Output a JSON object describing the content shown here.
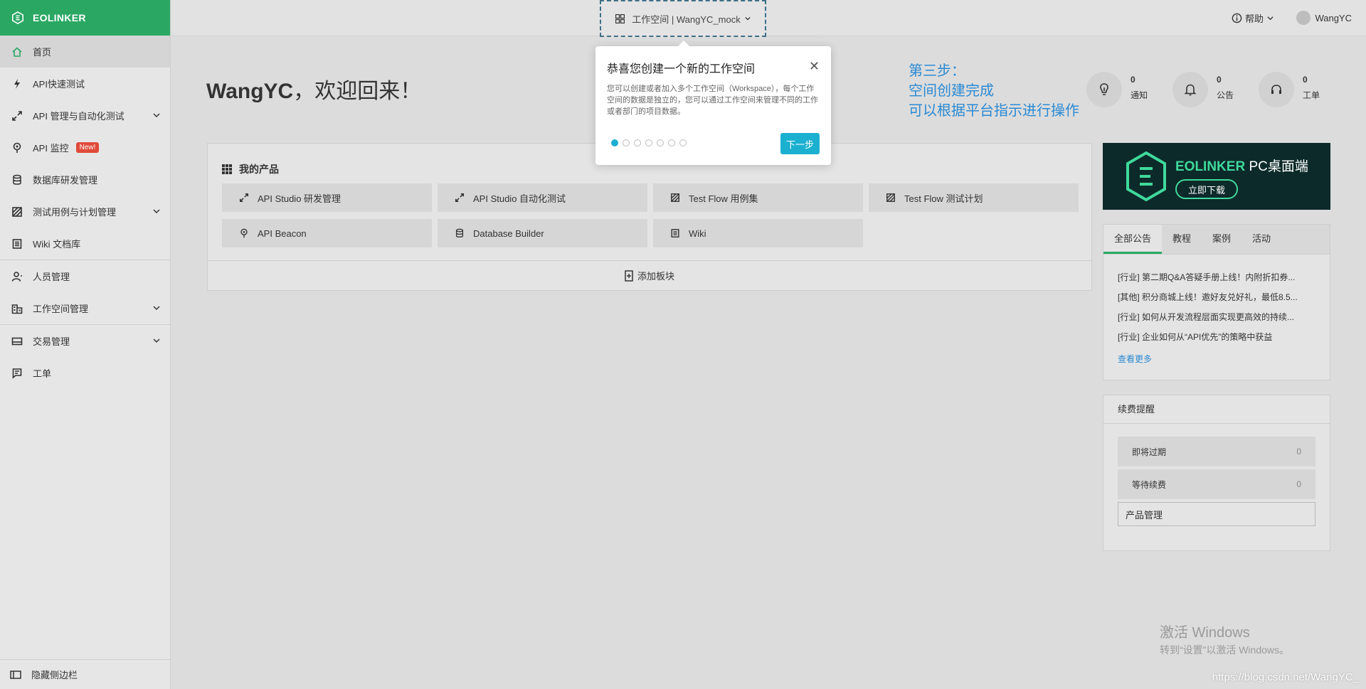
{
  "brand": {
    "name": "EOLINKER"
  },
  "sidebar": {
    "items": [
      {
        "label": "首页",
        "icon": "home-icon",
        "active": true
      },
      {
        "label": "API快速测试",
        "icon": "bolt-icon"
      },
      {
        "label": "API 管理与自动化测试",
        "icon": "api-icon",
        "expandable": true
      },
      {
        "label": "API 监控",
        "icon": "monitor-icon",
        "badge": "New!"
      },
      {
        "label": "数据库研发管理",
        "icon": "database-icon"
      },
      {
        "label": "测试用例与计划管理",
        "icon": "testcase-icon",
        "expandable": true
      },
      {
        "label": "Wiki 文档库",
        "icon": "wiki-icon"
      },
      {
        "label": "人员管理",
        "icon": "people-icon"
      },
      {
        "label": "工作空间管理",
        "icon": "building-icon",
        "expandable": true
      },
      {
        "label": "交易管理",
        "icon": "card-icon",
        "expandable": true
      },
      {
        "label": "工单",
        "icon": "ticket-icon"
      }
    ],
    "collapse_label": "隐藏侧边栏"
  },
  "topbar": {
    "workspace_label": "工作空间 | WangYC_mock",
    "help_label": "帮助",
    "user_name": "WangYC"
  },
  "welcome": {
    "name": "WangYC",
    "greeting": "，欢迎回来！"
  },
  "step_note": {
    "line1": "第三步：",
    "line2": "空间创建完成",
    "line3": "可以根据平台指示进行操作"
  },
  "stats": [
    {
      "count": "0",
      "label": "通知",
      "icon": "bulb-icon"
    },
    {
      "count": "0",
      "label": "公告",
      "icon": "bell-icon"
    },
    {
      "count": "0",
      "label": "工单",
      "icon": "headset-icon"
    }
  ],
  "products": {
    "title": "我的产品",
    "items": [
      {
        "label": "API Studio 研发管理",
        "icon": "api-icon"
      },
      {
        "label": "API Studio 自动化测试",
        "icon": "api-icon"
      },
      {
        "label": "Test Flow 用例集",
        "icon": "testcase-icon"
      },
      {
        "label": "Test Flow 测试计划",
        "icon": "testcase-icon"
      },
      {
        "label": "API Beacon",
        "icon": "monitor-icon"
      },
      {
        "label": "Database Builder",
        "icon": "database-icon"
      },
      {
        "label": "Wiki",
        "icon": "wiki-icon"
      }
    ],
    "add_label": "添加板块"
  },
  "banner": {
    "brand": "EOLINKER",
    "title": "PC桌面端",
    "button": "立即下载"
  },
  "news": {
    "tabs": [
      "全部公告",
      "教程",
      "案例",
      "活动"
    ],
    "items": [
      "[行业] 第二期Q&A答疑手册上线！内附折扣券...",
      "[其他] 积分商城上线！邀好友兑好礼，最低8.5...",
      "[行业] 如何从开发流程层面实现更高效的持续...",
      "[行业] 企业如何从“API优先”的策略中获益"
    ],
    "more": "查看更多"
  },
  "renew": {
    "title": "续费提醒",
    "rows": [
      {
        "label": "即将过期",
        "value": "0"
      },
      {
        "label": "等待续费",
        "value": "0"
      }
    ],
    "manage": "产品管理"
  },
  "guide": {
    "title": "恭喜您创建一个新的工作空间",
    "desc": "您可以创建或者加入多个工作空间（Workspace），每个工作空间的数据是独立的，您可以通过工作空间来管理不同的工作或者部门的项目数据。",
    "next": "下一步",
    "steps_total": 7,
    "step_current": 1
  },
  "watermark": {
    "activate1": "激活 Windows",
    "activate2": "转到“设置”以激活 Windows。",
    "csdn": "https://blog.csdn.net/WangYC_"
  },
  "colors": {
    "brand_green": "#2aa863",
    "accent_cyan": "#1bb0d0",
    "note_blue": "#2a8ad4"
  }
}
